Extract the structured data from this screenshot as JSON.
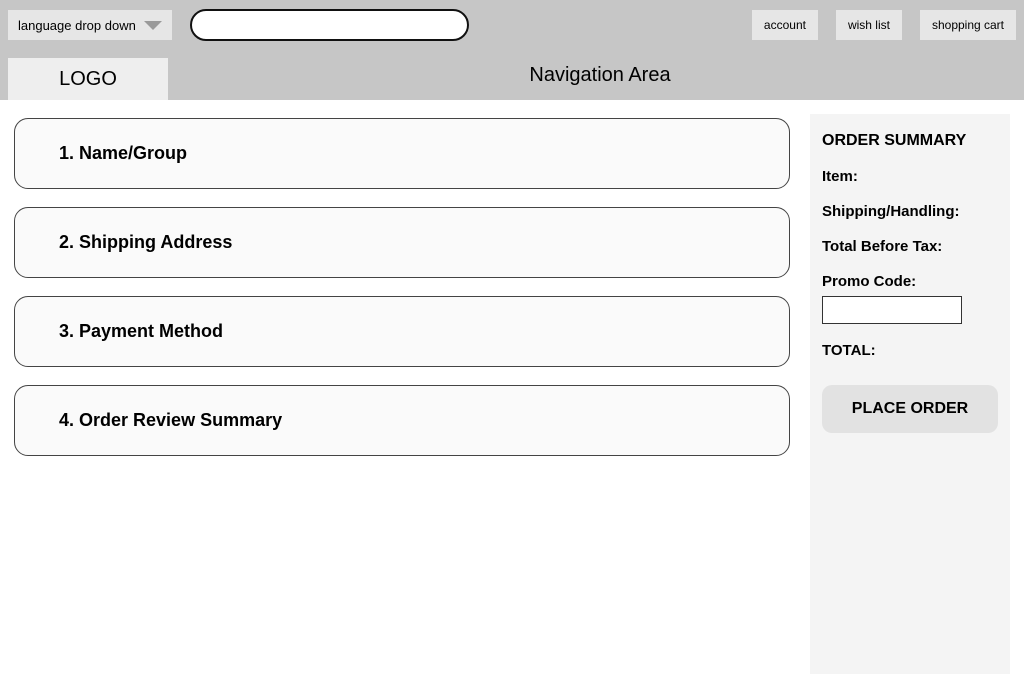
{
  "topbar": {
    "language_label": "language drop down",
    "search_placeholder": "",
    "account_label": "account",
    "wishlist_label": "wish list",
    "cart_label": "shopping cart"
  },
  "header": {
    "logo": "LOGO",
    "nav": "Navigation Area"
  },
  "steps": [
    {
      "label": "1. Name/Group"
    },
    {
      "label": "2. Shipping Address"
    },
    {
      "label": "3. Payment Method"
    },
    {
      "label": "4. Order Review Summary"
    }
  ],
  "summary": {
    "title": "ORDER SUMMARY",
    "item_label": "Item:",
    "shipping_label": "Shipping/Handling:",
    "pretax_label": "Total Before Tax:",
    "promo_label": "Promo Code:",
    "total_label": "TOTAL:",
    "place_order_label": "PLACE ORDER"
  }
}
